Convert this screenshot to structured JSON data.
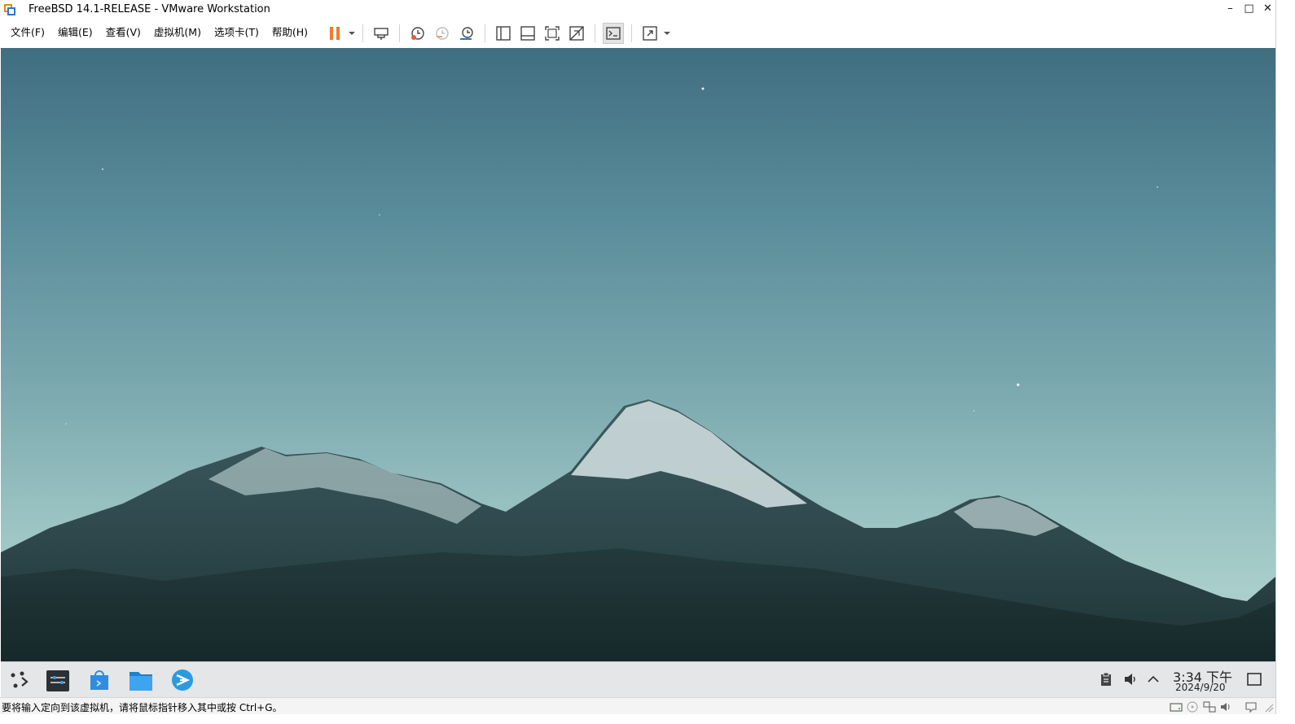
{
  "window": {
    "title": "FreeBSD 14.1-RELEASE - VMware Workstation",
    "controls": {
      "minimize": "–",
      "maximize": "□",
      "close": "✕"
    }
  },
  "menu": [
    {
      "label": "文件(F)"
    },
    {
      "label": "编辑(E)"
    },
    {
      "label": "查看(V)"
    },
    {
      "label": "虚拟机(M)"
    },
    {
      "label": "选项卡(T)"
    },
    {
      "label": "帮助(H)"
    }
  ],
  "toolbar": {
    "icons": [
      "pause-icon",
      "send-keys-icon",
      "snapshot-icon",
      "revert-snapshot-icon",
      "snapshot-manager-icon",
      "library-view-icon",
      "thumbnail-view-icon",
      "fullscreen-icon",
      "unity-icon",
      "console-view-icon",
      "stretch-icon"
    ],
    "accent": "#f07b2a"
  },
  "guest": {
    "taskbar_apps": [
      "app-launcher-icon",
      "system-settings-icon",
      "software-store-icon",
      "file-manager-icon",
      "web-browser-icon"
    ],
    "tray": [
      "clipboard-icon",
      "volume-icon",
      "expand-tray-icon"
    ],
    "clock": {
      "time": "3:34 下午",
      "date": "2024/9/20"
    }
  },
  "statusbar": {
    "message": "要将输入定向到该虚拟机，请将鼠标指针移入其中或按 Ctrl+G。",
    "icons": [
      "hard-disk-icon",
      "cd-dvd-icon",
      "network-icon",
      "sound-card-icon",
      "message-icon",
      "resize-grip-icon"
    ]
  }
}
